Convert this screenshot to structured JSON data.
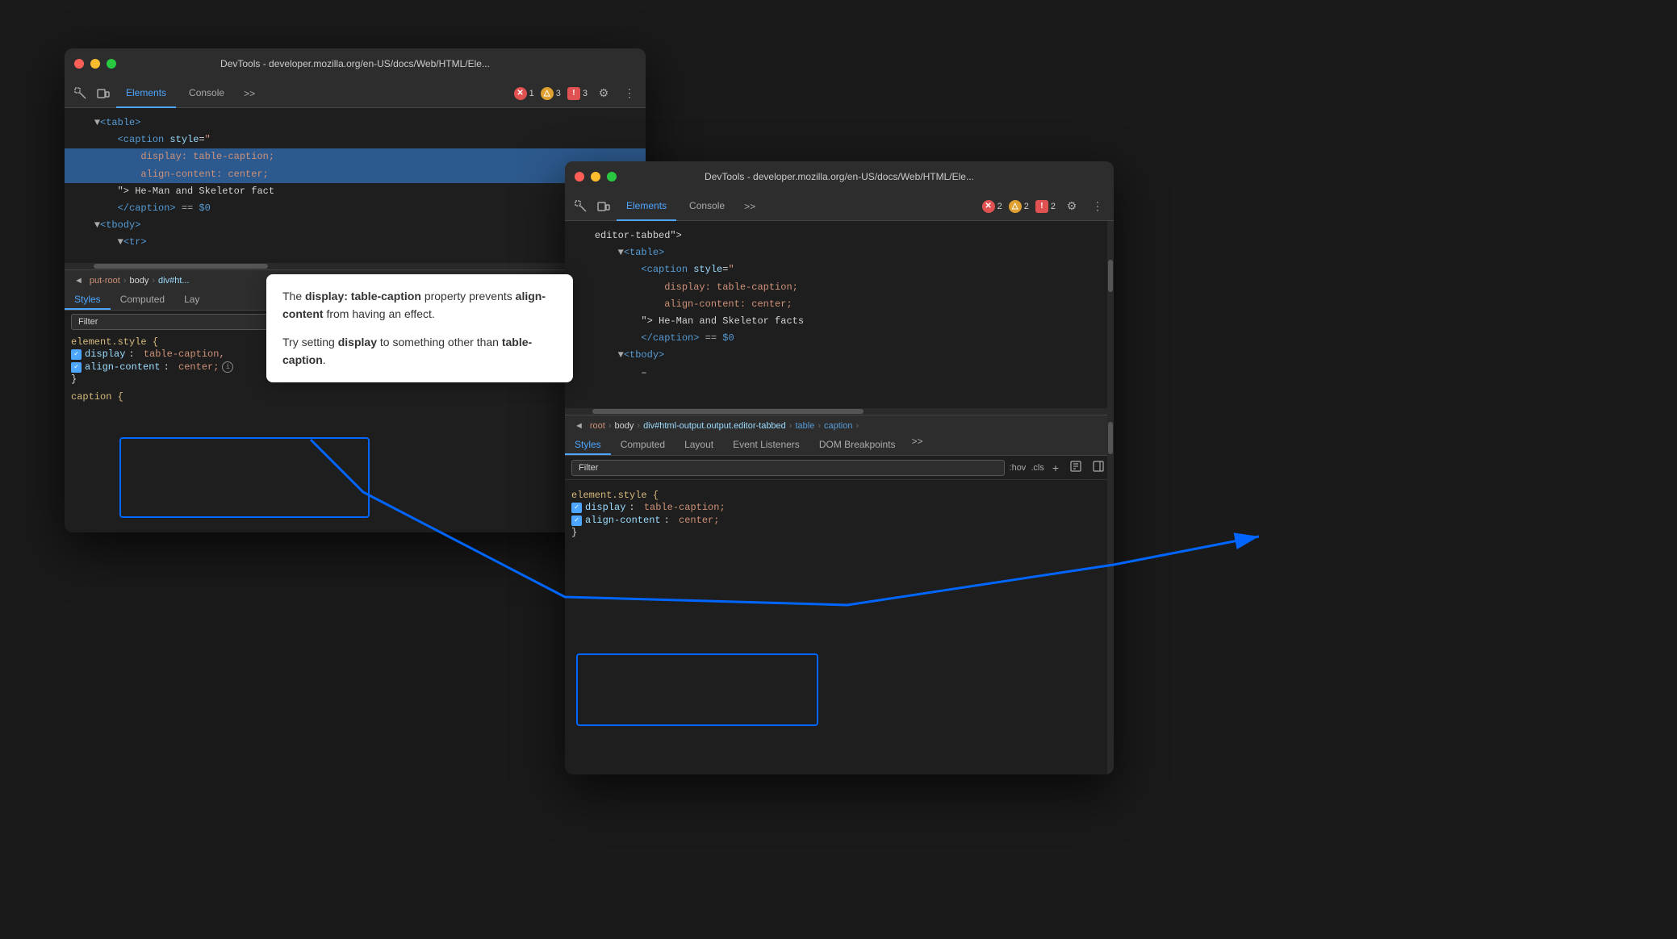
{
  "window1": {
    "title": "DevTools - developer.mozilla.org/en-US/docs/Web/HTML/Ele...",
    "tabs": [
      "Elements",
      "Console"
    ],
    "activeTab": "Elements",
    "badges": {
      "error": {
        "count": "1",
        "icon": "✕"
      },
      "warn": {
        "count": "3",
        "icon": "△"
      },
      "info": {
        "count": "3",
        "icon": "!"
      }
    },
    "html": [
      {
        "indent": 0,
        "content": "▼<table>",
        "selected": false
      },
      {
        "indent": 1,
        "content": "<caption style=\"",
        "selected": false
      },
      {
        "indent": 2,
        "content": "display: table-caption;",
        "selected": true
      },
      {
        "indent": 2,
        "content": "align-content: center;",
        "selected": true
      },
      {
        "indent": 1,
        "content": "\"> He-Man and Skeletor fact",
        "selected": false
      },
      {
        "indent": 1,
        "content": "</caption> == $0",
        "selected": false
      },
      {
        "indent": 0,
        "content": "▼<tbody>",
        "selected": false
      },
      {
        "indent": 1,
        "content": "▼<tr>",
        "selected": false
      }
    ],
    "breadcrumb": {
      "back": "◄",
      "items": [
        "put-root",
        "body",
        "div#ht..."
      ]
    },
    "stylesTabs": [
      "Styles",
      "Computed",
      "Lay"
    ],
    "filter": "Filter",
    "elementStyle": {
      "selector": "element.style {",
      "properties": [
        {
          "name": "display",
          "value": "table-caption,"
        },
        {
          "name": "align-content",
          "value": "center;"
        }
      ],
      "close": "}"
    },
    "captionRule": "caption {"
  },
  "window2": {
    "title": "DevTools - developer.mozilla.org/en-US/docs/Web/HTML/Ele...",
    "tabs": [
      "Elements",
      "Console"
    ],
    "activeTab": "Elements",
    "badges": {
      "error": {
        "count": "2"
      },
      "warn": {
        "count": "2"
      },
      "info": {
        "count": "2"
      }
    },
    "html": [
      {
        "indent": 0,
        "content": "editor-tabbed\">",
        "selected": false
      },
      {
        "indent": 1,
        "content": "▼<table>",
        "selected": false
      },
      {
        "indent": 2,
        "content": "<caption style=\"",
        "selected": false
      },
      {
        "indent": 3,
        "content": "display: table-caption;",
        "selected": false
      },
      {
        "indent": 3,
        "content": "align-content: center;",
        "selected": false
      },
      {
        "indent": 2,
        "content": "\"> He-Man and Skeletor facts",
        "selected": false
      },
      {
        "indent": 2,
        "content": "</caption> == $0",
        "selected": false
      },
      {
        "indent": 1,
        "content": "▼<tbody>",
        "selected": false
      },
      {
        "indent": 2,
        "content": "–",
        "selected": false
      }
    ],
    "breadcrumb": {
      "back": "◄",
      "items": [
        "root",
        "body",
        "div#html-output.output.editor-tabbed",
        "table",
        "caption"
      ]
    },
    "stylesTabs": [
      "Styles",
      "Computed",
      "Layout",
      "Event Listeners",
      "DOM Breakpoints"
    ],
    "filter": "Filter",
    "filterRight": [
      ":hov",
      ".cls",
      "+",
      "□",
      "⊡"
    ],
    "elementStyle": {
      "selector": "element.style {",
      "properties": [
        {
          "name": "display",
          "value": "table-caption;"
        },
        {
          "name": "align-content",
          "value": "center;"
        }
      ],
      "close": "}"
    }
  },
  "tooltip": {
    "text1_before": "The ",
    "text1_bold": "display: table-caption",
    "text1_after": " property prevents ",
    "text2_bold": "align-content",
    "text2_after": " from having an effect.",
    "text3_before": "Try setting ",
    "text3_bold": "display",
    "text3_after": " to something other than ",
    "text4_bold": "table-caption",
    "text4_end": "."
  },
  "icons": {
    "inspect": "⬚",
    "device": "⊡",
    "more": "»",
    "gear": "⚙",
    "menu": "⋮"
  }
}
